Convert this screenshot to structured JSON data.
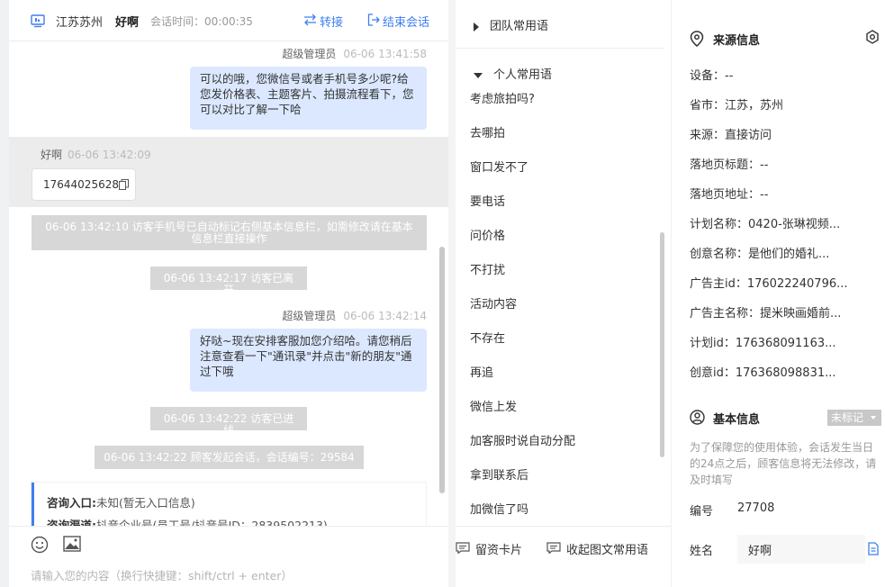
{
  "header": {
    "location": "江苏苏州",
    "visitor_name": "好啊",
    "session_time": "会话时间：00:00:35",
    "transfer_label": "转接",
    "end_label": "结束会话"
  },
  "messages": {
    "agent1_meta_name": "超级管理员",
    "agent1_meta_time": "06-06 13:41:58",
    "agent1_text": "可以的哦，您微信号或者手机号多少呢?给您发价格表、主题客片、拍摄流程看下，您可以对比了解一下哈",
    "visitor_meta_name": "好啊",
    "visitor_meta_time": "06-06 13:42:09",
    "visitor_text": "17644025628",
    "sys1": "06-06 13:42:10 访客手机号已自动标记右侧基本信息栏，如需修改请在基本信息栏直接操作",
    "sys2": "06-06 13:42:17 访客已离开",
    "agent2_meta_name": "超级管理员",
    "agent2_meta_time": "06-06 13:42:14",
    "agent2_text": "好哒~现在安排客服加您介绍哈。请您稍后注意查看一下\"通讯录\"并点击\"新的朋友\"通过下哦",
    "sys3": "06-06 13:42:22 访客已进线",
    "sys4": "06-06 13:42:22 顾客发起会话，会话编号：29584",
    "card_row1_label": "咨询入口:",
    "card_row1_value": "未知(暂无入口信息)",
    "card_row2_label": "咨询渠道:",
    "card_row2_value": "抖音企业号(员工号/抖音号ID：2839502213)"
  },
  "composer": {
    "placeholder": "请输入您的内容（换行快捷键：shift/ctrl + enter）"
  },
  "phrases": {
    "team_group": "团队常用语",
    "personal_group": "个人常用语",
    "items": [
      "考虑旅拍吗?",
      "去哪拍",
      "窗口发不了",
      "要电话",
      "问价格",
      "不打扰",
      "活动内容",
      "不存在",
      "再追",
      "微信上发",
      "加客服时说自动分配",
      "拿到联系后",
      "加微信了吗"
    ],
    "card_button": "留资卡片",
    "collapse_button": "收起图文常用语"
  },
  "source": {
    "title": "来源信息",
    "device": "设备：--",
    "province": "省市：江苏，苏州",
    "origin": "来源：直接访问",
    "landing_title": "落地页标题：--",
    "landing_url": "落地页地址：--",
    "plan_name": "计划名称：0420-张琳视频...",
    "creative_name": "创意名称：是他们的婚礼...",
    "advertiser_id": "广告主id：176022240796...",
    "advertiser_name": "广告主名称：提米映画婚前...",
    "plan_id": "计划id：176368091163...",
    "creative_id": "创意id：176368098831..."
  },
  "basic": {
    "title": "基本信息",
    "tag": "未标记",
    "notice": "为了保障您的使用体验，会话发生当日的24点之后，顾客信息将无法修改，请及时填写",
    "id_label": "编号",
    "id_value": "27708",
    "name_label": "姓名",
    "name_value": "好啊"
  },
  "colors": {
    "accent": "#3d7ff0",
    "agent_bubble": "#dbe8ff",
    "system_msg": "#d7d7d7"
  }
}
